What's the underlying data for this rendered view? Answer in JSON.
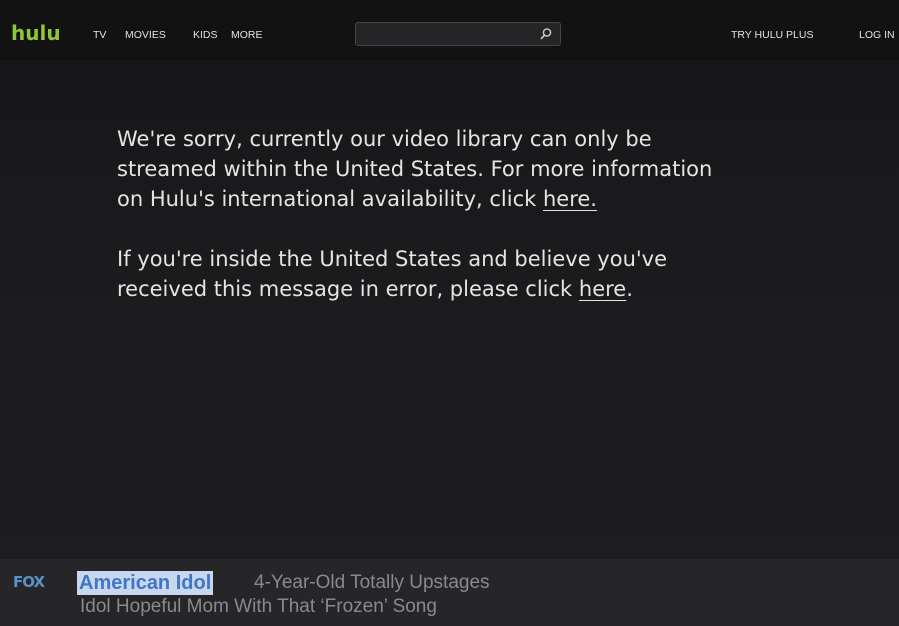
{
  "header": {
    "logo": "hulu",
    "nav": [
      "TV",
      "MOVIES",
      "KIDS",
      "MORE"
    ],
    "search_placeholder": "",
    "try_plus": "TRY HULU PLUS",
    "login": "LOG IN"
  },
  "message": {
    "p1_line1": "We're sorry, currently our video library can only be",
    "p1_line2": "streamed within the United States. For more information",
    "p1_line3_prefix": "on Hulu's international availability, click ",
    "p1_link": "here.",
    "p2_line1": "If you're inside the United States and believe you've",
    "p2_line2_prefix": "received this message in error, please click ",
    "p2_link": "here",
    "p2_suffix": "."
  },
  "bottom": {
    "network": "FOX",
    "tag": "American Idol",
    "headline_line1": "4-Year-Old Totally Upstages",
    "headline_line2": "Idol Hopeful Mom With That ‘Frozen’ Song"
  },
  "colors": {
    "logo": "#8cc63f",
    "background": "#1a1a1c",
    "tag_highlight": "#c8d7ee",
    "tag_text": "#3f76c7",
    "fox": "#5a8fc8"
  },
  "icons": {
    "search": "search-icon"
  }
}
